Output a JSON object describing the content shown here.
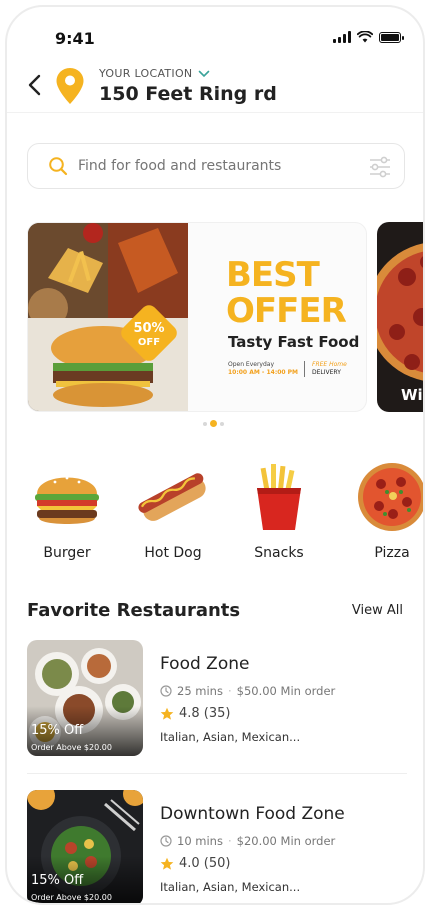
{
  "status": {
    "time": "9:41"
  },
  "header": {
    "location_label": "YOUR LOCATION",
    "location_name": "150 Feet Ring rd"
  },
  "search": {
    "placeholder": "Find for food and restaurants"
  },
  "banner": {
    "badge_percent": "50%",
    "badge_off": "OFF",
    "headline_1": "BEST",
    "headline_2": "OFFER",
    "subtitle": "Tasty Fast Food",
    "open_label": "Open Everyday",
    "open_hours": "10:00 AM - 14:00 PM",
    "free_label": "FREE Home",
    "delivery_label": "DELIVERY",
    "next_banner_text": "Wi"
  },
  "carousel": {
    "page_count": 3,
    "active_index": 1
  },
  "categories": [
    {
      "label": "Burger",
      "icon": "burger-icon"
    },
    {
      "label": "Hot Dog",
      "icon": "hotdog-icon"
    },
    {
      "label": "Snacks",
      "icon": "fries-icon"
    },
    {
      "label": "Pizza",
      "icon": "pizza-icon"
    }
  ],
  "favorites": {
    "title": "Favorite Restaurants",
    "view_all": "View All",
    "items": [
      {
        "name": "Food Zone",
        "time": "25 mins",
        "min_order": "$50.00 Min order",
        "rating": "4.8 (35)",
        "cuisine": "Italian, Asian, Mexican...",
        "discount": "15% Off",
        "discount_note": "Order Above $20.00"
      },
      {
        "name": "Downtown Food Zone",
        "time": "10 mins",
        "min_order": "$20.00 Min order",
        "rating": "4.0 (50)",
        "cuisine": "Italian, Asian, Mexican...",
        "discount": "15% Off",
        "discount_note": "Order Above $20.00"
      }
    ]
  },
  "colors": {
    "accent": "#F5B320",
    "text": "#222222"
  }
}
